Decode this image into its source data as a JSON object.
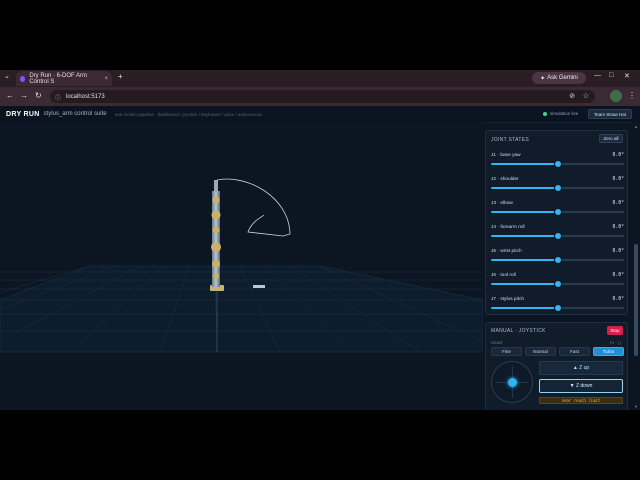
{
  "browser": {
    "tab_title": "Dry Run · 6-DOF Arm Control S",
    "tab_close": "×",
    "new_tab": "+",
    "ask_gemini": "Ask Gemini",
    "url": "localhost:5173",
    "window_controls": [
      "—",
      "□",
      "✕"
    ]
  },
  "app": {
    "brand": "DRY RUN",
    "suite": "stylus_arm control suite",
    "pipeline": "one motion pipeline · dashboard / joystick / keyboard / voice / autonomous",
    "status": "simulation live",
    "hat_button": "Team Straw Hat"
  },
  "joint_states": {
    "title": "JOINT STATES",
    "zero_all": "Zero all",
    "joints": [
      {
        "label": "J1 · base yaw",
        "value": "0.0°",
        "fraction": 0.5
      },
      {
        "label": "J2 · shoulder",
        "value": "0.0°",
        "fraction": 0.5
      },
      {
        "label": "J3 · elbow",
        "value": "0.0°",
        "fraction": 0.5
      },
      {
        "label": "J4 · forearm roll",
        "value": "0.0°",
        "fraction": 0.5
      },
      {
        "label": "J5 · wrist pitch",
        "value": "0.0°",
        "fraction": 0.5
      },
      {
        "label": "J6 · tool roll",
        "value": "0.0°",
        "fraction": 0.5
      },
      {
        "label": "J7 · stylus pitch",
        "value": "0.0°",
        "fraction": 0.5
      }
    ]
  },
  "manual": {
    "title": "MANUAL · JOYSTICK",
    "stop": "Stop",
    "gear_label": "GEAR",
    "gear_value": "Fx · | |",
    "gears": [
      "Fine",
      "Normal",
      "Fast",
      "Turbo"
    ],
    "active_gear": "Turbo",
    "z_up": "▲ Z up",
    "z_down": "▼ Z down",
    "reach_warning": "near reach limit"
  },
  "colors": {
    "accent": "#33b6ef",
    "stop": "#d4204a",
    "warning": "#e5b950"
  }
}
